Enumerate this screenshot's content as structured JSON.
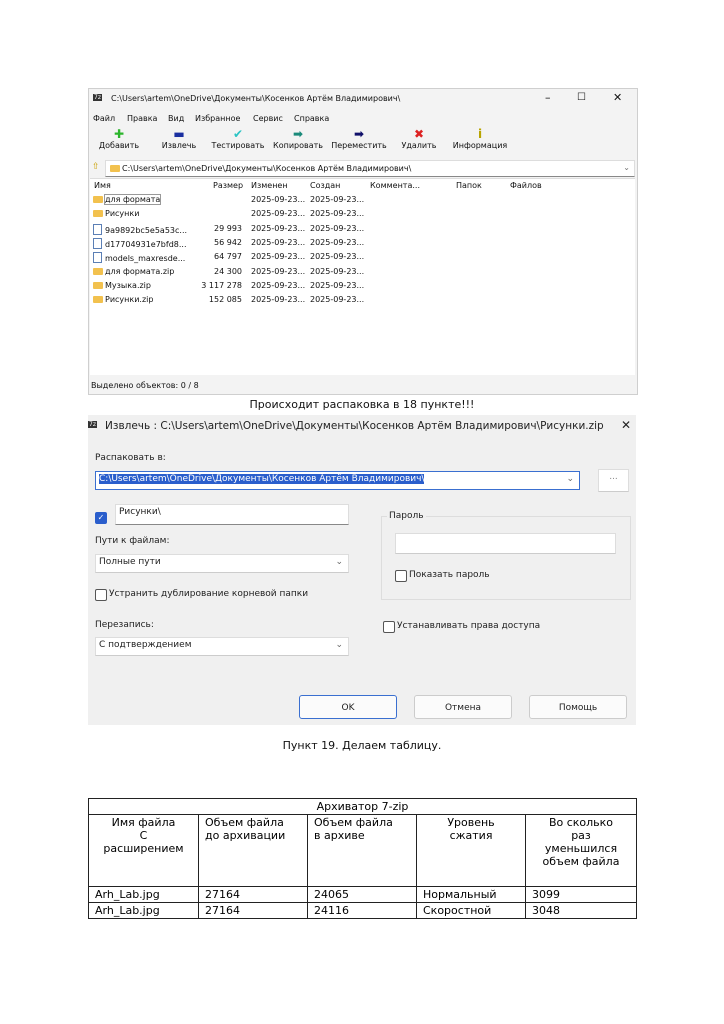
{
  "fm": {
    "title": "C:\\Users\\artem\\OneDrive\\Документы\\Косенков Артём Владимирович\\",
    "menu": [
      "Файл",
      "Правка",
      "Вид",
      "Избранное",
      "Сервис",
      "Справка"
    ],
    "toolbar": [
      "Добавить",
      "Извлечь",
      "Тестировать",
      "Копировать",
      "Переместить",
      "Удалить",
      "Информация"
    ],
    "address": "C:\\Users\\artem\\OneDrive\\Документы\\Косенков Артём Владимирович\\",
    "columns": [
      "Имя",
      "Размер",
      "Изменен",
      "Создан",
      "Коммента...",
      "Папок",
      "Файлов"
    ],
    "rows": [
      {
        "name": "для формата",
        "size": "",
        "mod": "2025-09-23...",
        "cr": "2025-09-23..."
      },
      {
        "name": "Рисунки",
        "size": "",
        "mod": "2025-09-23...",
        "cr": "2025-09-23..."
      },
      {
        "name": "9a9892bc5e5a53c...",
        "size": "29 993",
        "mod": "2025-09-23...",
        "cr": "2025-09-23..."
      },
      {
        "name": "d17704931e7bfd8...",
        "size": "56 942",
        "mod": "2025-09-23...",
        "cr": "2025-09-23..."
      },
      {
        "name": "models_maxresde...",
        "size": "64 797",
        "mod": "2025-09-23...",
        "cr": "2025-09-23..."
      },
      {
        "name": "для формата.zip",
        "size": "24 300",
        "mod": "2025-09-23...",
        "cr": "2025-09-23..."
      },
      {
        "name": "Музыка.zip",
        "size": "3 117 278",
        "mod": "2025-09-23...",
        "cr": "2025-09-23..."
      },
      {
        "name": "Рисунки.zip",
        "size": "152 085",
        "mod": "2025-09-23...",
        "cr": "2025-09-23..."
      }
    ],
    "status": "Выделено объектов: 0 / 8"
  },
  "caption1": "Происходит распаковка в 18 пункте!!!",
  "dlg": {
    "title": "Извлечь : C:\\Users\\artem\\OneDrive\\Документы\\Косенков Артём Владимирович\\Рисунки.zip",
    "extract_to_label": "Распаковать в:",
    "extract_to": "C:\\Users\\artem\\OneDrive\\Документы\\Косенков Артём Владимирович\\",
    "browse": "...",
    "subfolder": "Рисунки\\",
    "paths_label": "Пути к файлам:",
    "paths": "Полные пути",
    "dedupe": "Устранить дублирование корневой папки",
    "overwrite_label": "Перезапись:",
    "overwrite": "С подтверждением",
    "password_label": "Пароль",
    "show_password": "Показать пароль",
    "set_rights": "Устанавливать права доступа",
    "ok": "OK",
    "cancel": "Отмена",
    "help": "Помощь"
  },
  "caption2": "Пункт 19. Делаем таблицу.",
  "table": {
    "title": "Архиватор 7-zip",
    "headers": [
      "Имя файла\nС\nрасширением",
      "Объем файла\nдо архивации",
      "Объем файла\nв архиве",
      "Уровень\nсжатия",
      "Во сколько\nраз\nуменьшился\nобъем файла"
    ],
    "rows": [
      [
        "Arh_Lab.jpg",
        "27164",
        "24065",
        "Нормальный",
        "3099"
      ],
      [
        "Arh_Lab.jpg",
        "27164",
        "24116",
        "Скоростной",
        "3048"
      ]
    ]
  }
}
